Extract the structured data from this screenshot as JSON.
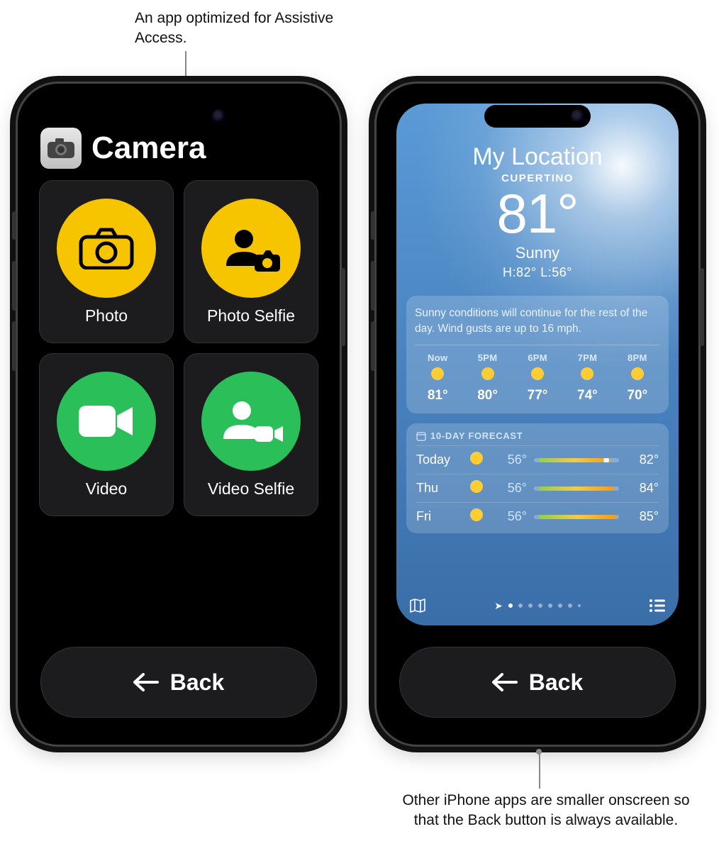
{
  "callouts": {
    "top": "An app optimized for Assistive Access.",
    "bottom": "Other iPhone apps are smaller onscreen so that the Back button is always available."
  },
  "camera": {
    "title": "Camera",
    "tiles": {
      "photo": "Photo",
      "photo_selfie": "Photo Selfie",
      "video": "Video",
      "video_selfie": "Video Selfie"
    },
    "back_label": "Back"
  },
  "weather": {
    "back_label": "Back",
    "header": {
      "my_location": "My Location",
      "city": "CUPERTINO",
      "temp": "81°",
      "condition": "Sunny",
      "hilo": "H:82°  L:56°"
    },
    "summary": "Sunny conditions will continue for the rest of the day. Wind gusts are up to 16 mph.",
    "hourly": [
      {
        "time": "Now",
        "temp": "81°"
      },
      {
        "time": "5PM",
        "temp": "80°"
      },
      {
        "time": "6PM",
        "temp": "77°"
      },
      {
        "time": "7PM",
        "temp": "74°"
      },
      {
        "time": "8PM",
        "temp": "70°"
      }
    ],
    "forecast_title": "10-DAY FORECAST",
    "forecast": [
      {
        "day": "Today",
        "low": "56°",
        "high": "82°"
      },
      {
        "day": "Thu",
        "low": "56°",
        "high": "84°"
      },
      {
        "day": "Fri",
        "low": "56°",
        "high": "85°"
      }
    ]
  }
}
